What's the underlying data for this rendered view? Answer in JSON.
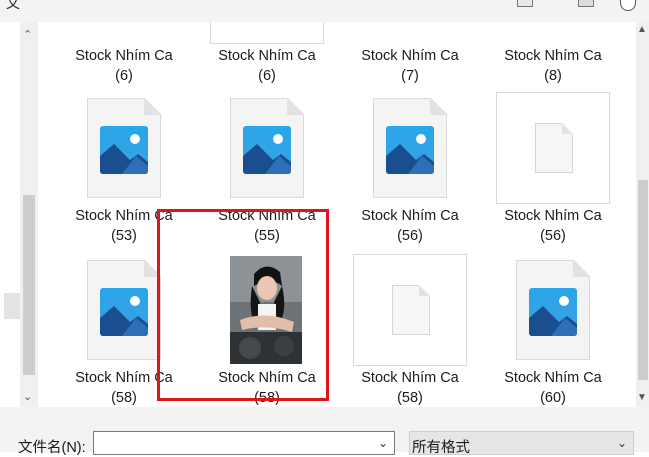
{
  "title_fragment": "文",
  "filename_label": "文件名(N):",
  "filename_value": "",
  "filter_selected": "所有格式",
  "icons": {
    "up": "▲",
    "down": "▼",
    "left_up": "⌃",
    "left_down": "⌄",
    "dropdown": "⌄"
  },
  "files": {
    "row1": [
      {
        "name": "Stock Nhím Ca",
        "num": "(6)"
      },
      {
        "name": "Stock Nhím Ca",
        "num": "(6)"
      },
      {
        "name": "Stock Nhím Ca",
        "num": "(7)"
      },
      {
        "name": "Stock Nhím Ca",
        "num": "(8)"
      }
    ],
    "row2": [
      {
        "name": "Stock Nhím Ca",
        "num": "(53)"
      },
      {
        "name": "Stock Nhím Ca",
        "num": "(55)"
      },
      {
        "name": "Stock Nhím Ca",
        "num": "(56)"
      },
      {
        "name": "Stock Nhím Ca",
        "num": "(56)"
      }
    ],
    "row3": [
      {
        "name": "Stock Nhím Ca",
        "num": "(58)"
      },
      {
        "name": "Stock Nhím Ca",
        "num": "(58)"
      },
      {
        "name": "Stock Nhím Ca",
        "num": "(58)"
      },
      {
        "name": "Stock Nhím Ca",
        "num": "(60)"
      }
    ]
  },
  "colors": {
    "selection": "#e0141e",
    "image_icon": "#29a6e8",
    "mountain_dark": "#1a4f8f"
  }
}
